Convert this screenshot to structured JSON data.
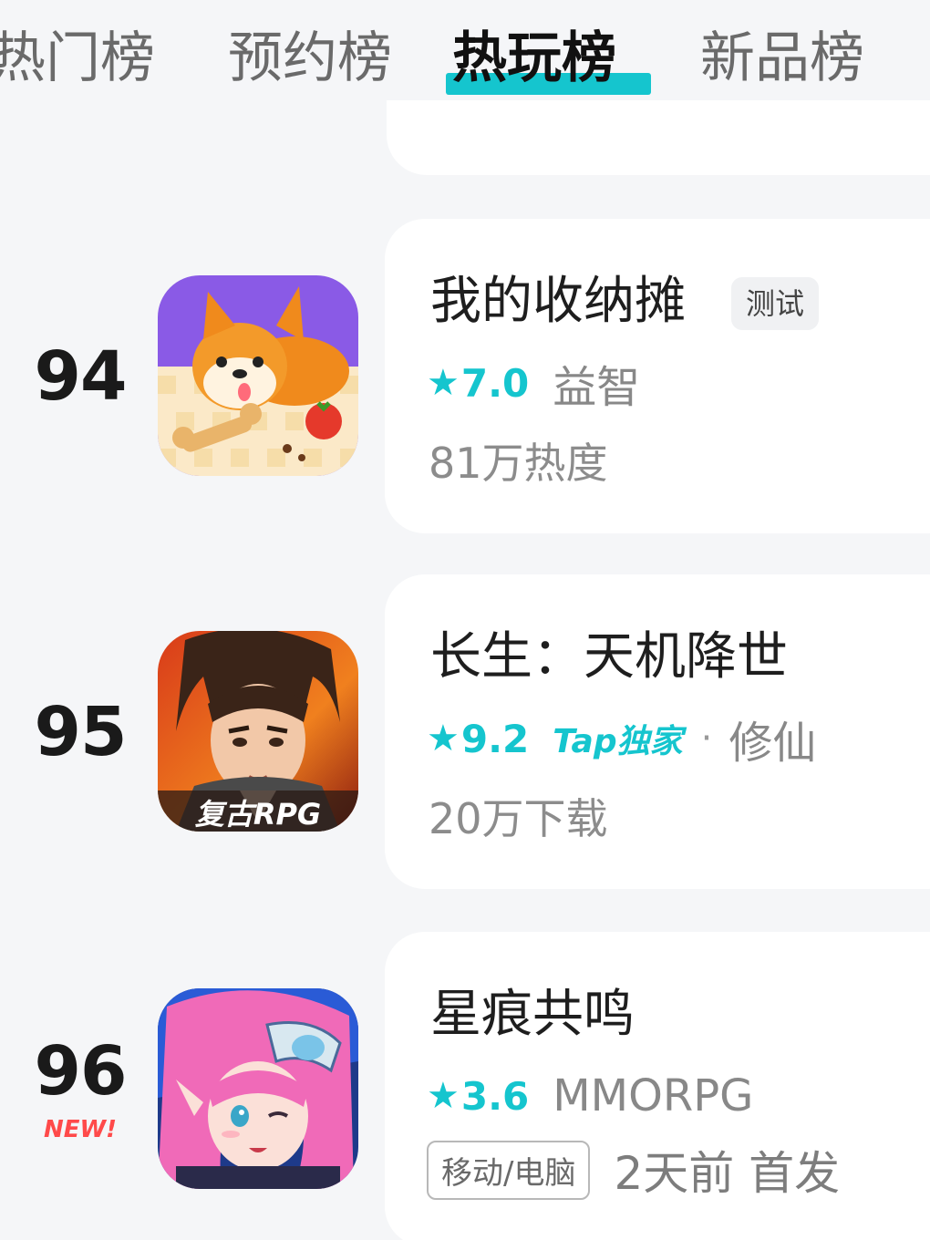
{
  "tabs": [
    {
      "label": "热门榜",
      "active": false
    },
    {
      "label": "预约榜",
      "active": false
    },
    {
      "label": "热玩榜",
      "active": true
    },
    {
      "label": "新品榜",
      "active": false
    }
  ],
  "accent_color": "#15c5ce",
  "games": [
    {
      "rank": "94",
      "title": "我的收纳摊",
      "badge": "测试",
      "star_icon": "star-icon",
      "score": "7.0",
      "genre": "益智",
      "stats": "81万热度"
    },
    {
      "rank": "95",
      "title": "长生：天机降世",
      "star_icon": "star-icon",
      "score": "9.2",
      "exclusive": "Tap独家",
      "separator": "·",
      "genre": "修仙",
      "stats": "20万下载",
      "icon_caption": "复古RPG"
    },
    {
      "rank": "96",
      "new_tag": "NEW!",
      "title": "星痕共鸣",
      "star_icon": "star-icon",
      "score": "3.6",
      "genre": "MMORPG",
      "platform": "移动/电脑",
      "release": "2天前 首发"
    }
  ]
}
